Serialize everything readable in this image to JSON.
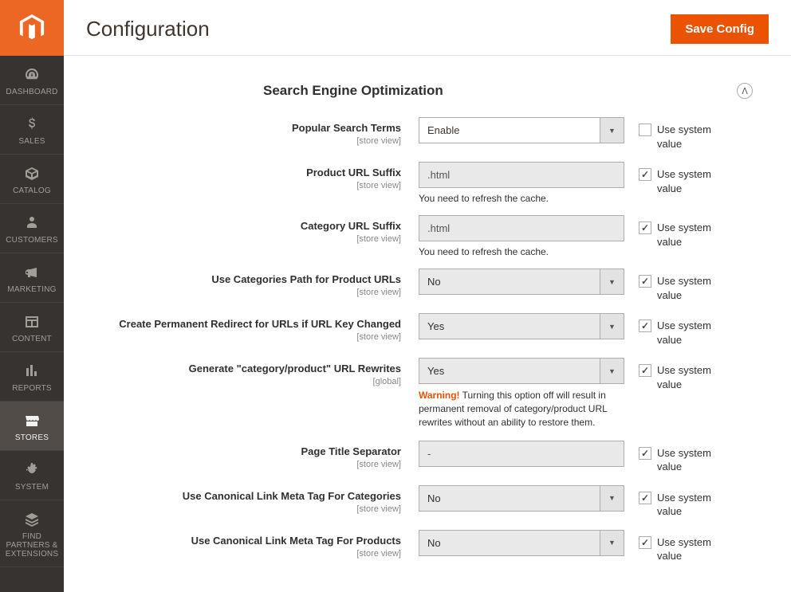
{
  "header": {
    "title": "Configuration",
    "save_button": "Save Config"
  },
  "sidebar": {
    "items": [
      {
        "label": "DASHBOARD"
      },
      {
        "label": "SALES"
      },
      {
        "label": "CATALOG"
      },
      {
        "label": "CUSTOMERS"
      },
      {
        "label": "MARKETING"
      },
      {
        "label": "CONTENT"
      },
      {
        "label": "REPORTS"
      },
      {
        "label": "STORES"
      },
      {
        "label": "SYSTEM"
      },
      {
        "label": "FIND PARTNERS & EXTENSIONS"
      }
    ]
  },
  "section": {
    "title": "Search Engine Optimization"
  },
  "fields": {
    "popular_search_terms": {
      "label": "Popular Search Terms",
      "scope": "[store view]",
      "value": "Enable",
      "use_system": false,
      "sys_label": "Use system value"
    },
    "product_url_suffix": {
      "label": "Product URL Suffix",
      "scope": "[store view]",
      "value": ".html",
      "note": "You need to refresh the cache.",
      "use_system": true,
      "sys_label": "Use system value"
    },
    "category_url_suffix": {
      "label": "Category URL Suffix",
      "scope": "[store view]",
      "value": ".html",
      "note": "You need to refresh the cache.",
      "use_system": true,
      "sys_label": "Use system value"
    },
    "use_categories_path": {
      "label": "Use Categories Path for Product URLs",
      "scope": "[store view]",
      "value": "No",
      "use_system": true,
      "sys_label": "Use system value"
    },
    "create_permanent_redirect": {
      "label": "Create Permanent Redirect for URLs if URL Key Changed",
      "scope": "[store view]",
      "value": "Yes",
      "use_system": true,
      "sys_label": "Use system value"
    },
    "generate_rewrites": {
      "label": "Generate \"category/product\" URL Rewrites",
      "scope": "[global]",
      "value": "Yes",
      "warn_prefix": "Warning!",
      "warn_text": " Turning this option off will result in permanent removal of category/product URL rewrites without an ability to restore them.",
      "use_system": true,
      "sys_label": "Use system value"
    },
    "page_title_separator": {
      "label": "Page Title Separator",
      "scope": "[store view]",
      "value": "-",
      "use_system": true,
      "sys_label": "Use system value"
    },
    "canonical_categories": {
      "label": "Use Canonical Link Meta Tag For Categories",
      "scope": "[store view]",
      "value": "No",
      "use_system": true,
      "sys_label": "Use system value"
    },
    "canonical_products": {
      "label": "Use Canonical Link Meta Tag For Products",
      "scope": "[store view]",
      "value": "No",
      "use_system": true,
      "sys_label": "Use system value"
    }
  }
}
